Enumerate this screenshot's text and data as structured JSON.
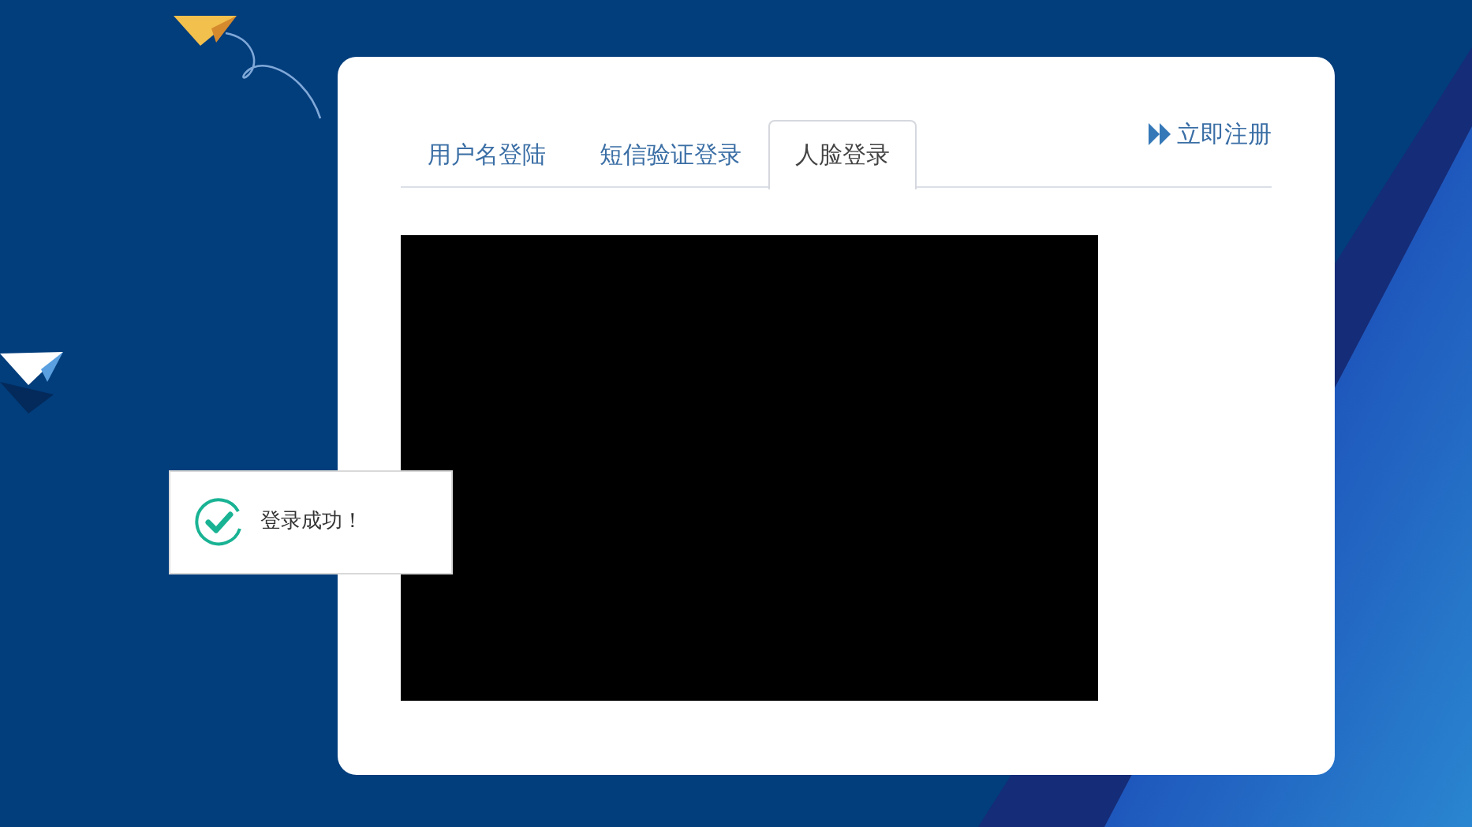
{
  "tabs": [
    {
      "label": "用户名登陆",
      "selected": false
    },
    {
      "label": "短信验证登录",
      "selected": false
    },
    {
      "label": "人脸登录",
      "selected": true
    }
  ],
  "register_link": {
    "label": "立即注册"
  },
  "camera": {
    "kind": "video"
  },
  "toast": {
    "kind": "success",
    "message": "登录成功！"
  }
}
